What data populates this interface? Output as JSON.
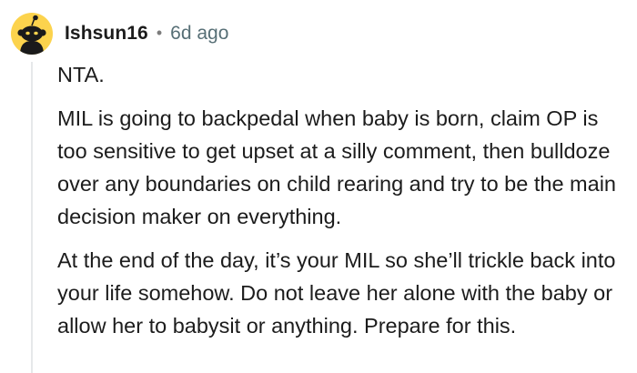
{
  "comment": {
    "author": "Ishsun16",
    "separator": "•",
    "timestamp": "6d ago",
    "avatar_icon": "snoo-avatar-icon",
    "paragraphs": [
      "NTA.",
      "MIL is going to backpedal when baby is born, claim OP is too sensitive to get upset at a silly comment, then bulldoze over any boundaries on child rearing and try to be the main decision maker on everything.",
      "At the end of the day, it’s your MIL so she’ll trickle back into your life somehow. Do not leave her alone with the baby or allow her to babysit or anything. Prepare for this."
    ]
  },
  "colors": {
    "avatar_bg": "#fcd34d",
    "text": "#1c1c1c",
    "meta": "#576f76",
    "thread_line": "#e6e8ea"
  }
}
